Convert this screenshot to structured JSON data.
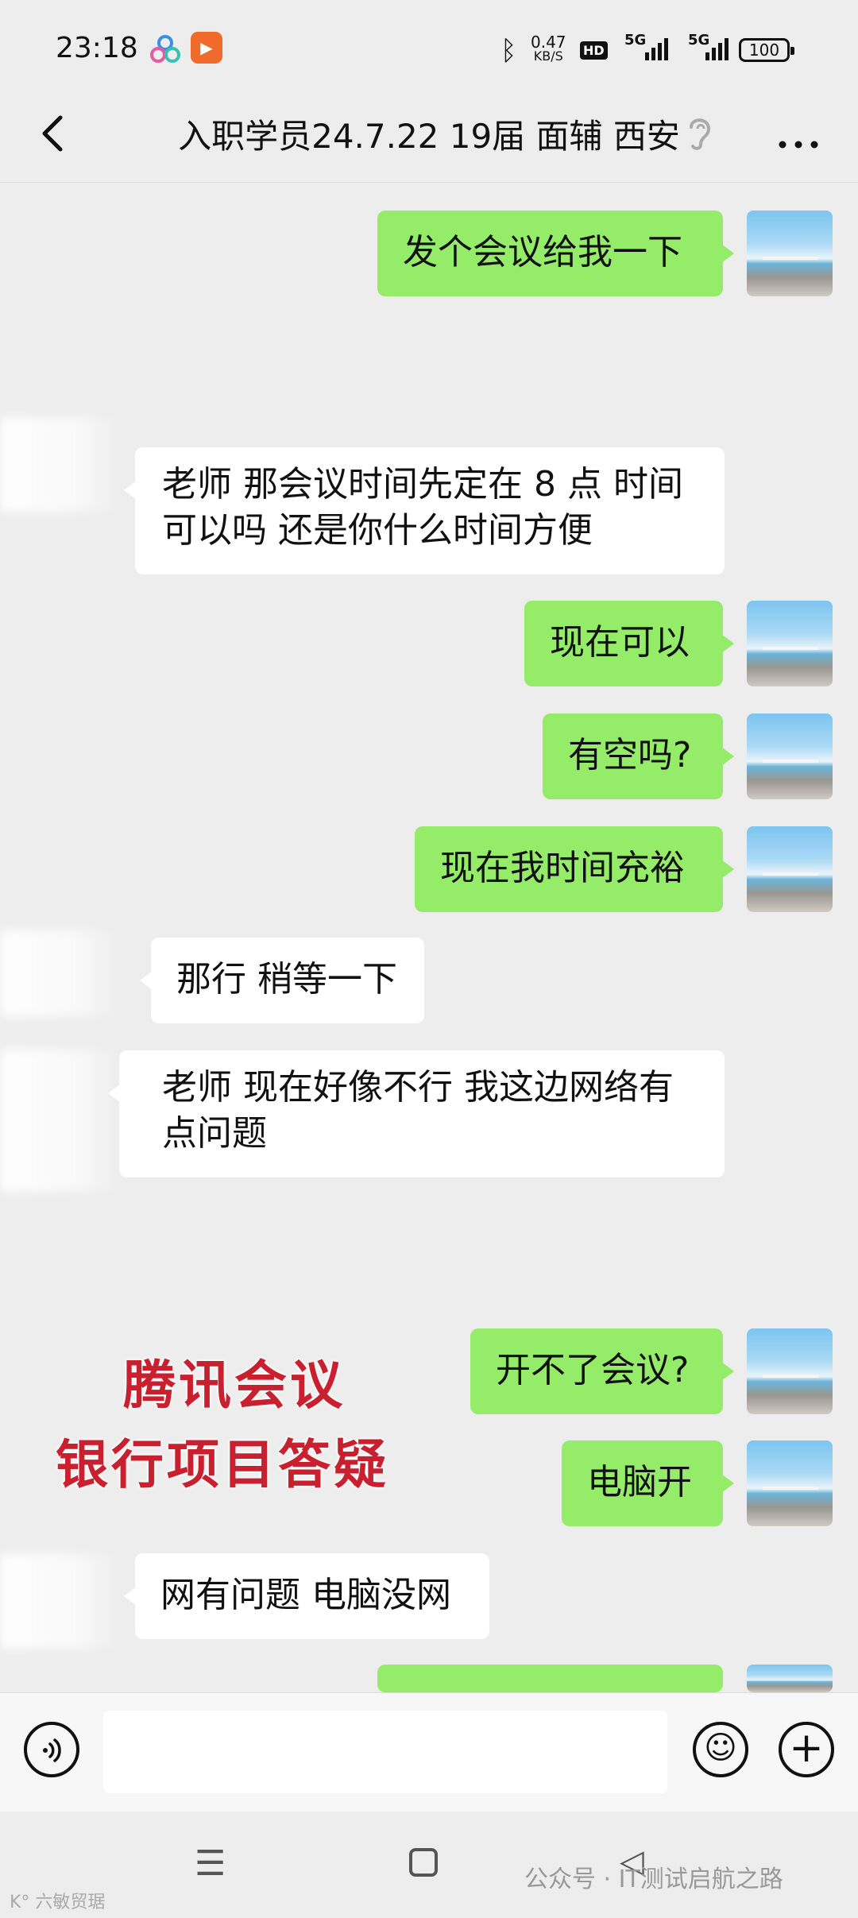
{
  "status_bar": {
    "time": "23:18",
    "speed_value": "0.47",
    "speed_unit": "KB/S",
    "hd_badge": "HD",
    "signal1_label": "5G",
    "signal2_label": "5G",
    "battery": "100"
  },
  "nav": {
    "title": "入职学员24.7.22 19届 面辅 西安",
    "back_icon": "chevron-left-icon",
    "earpiece_icon": "ear-icon",
    "more_icon": "more-icon"
  },
  "messages": [
    {
      "side": "out",
      "text": "发个会议给我一下"
    },
    {
      "side": "in",
      "text": "老师 那会议时间先定在 8 点 时间可以吗 还是你什么时间方便"
    },
    {
      "side": "out",
      "text": "现在可以"
    },
    {
      "side": "out",
      "text": "有空吗?"
    },
    {
      "side": "out",
      "text": "现在我时间充裕"
    },
    {
      "side": "in",
      "text": "那行 稍等一下"
    },
    {
      "side": "in",
      "text": "老师 现在好像不行 我这边网络有点问题"
    },
    {
      "side": "out",
      "text": "开不了会议?"
    },
    {
      "side": "out",
      "text": "电脑开"
    },
    {
      "side": "in",
      "text": "网有问题 电脑没网"
    }
  ],
  "overlay": {
    "line1": "腾讯会议",
    "line2": "银行项目答疑"
  },
  "input_bar": {
    "voice_icon": "voice-icon",
    "emoji_icon": "emoji-icon",
    "plus_icon": "plus-icon",
    "emoji_glyph": "☺",
    "plus_glyph": "+"
  },
  "system_nav": {
    "menu_glyph": "☰",
    "back_glyph": "◁"
  },
  "watermarks": {
    "right": "公众号 · IT测试启航之路",
    "left": "K° 六敏贸琚"
  },
  "colors": {
    "bubble_out": "#95ec69",
    "bubble_in": "#ffffff",
    "background": "#ededed",
    "overlay_red": "#c8202e"
  }
}
